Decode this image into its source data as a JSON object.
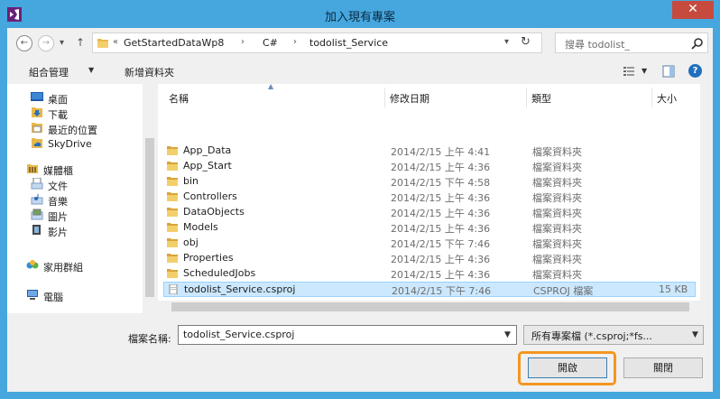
{
  "window": {
    "title": "加入現有專案",
    "close_label": "✕",
    "accent": "#46a7de"
  },
  "address": {
    "crumbs": [
      "«",
      "GetStartedDataWp8",
      "C#",
      "todolist_Service"
    ],
    "search_placeholder": "搜尋 todolist_"
  },
  "toolbar": {
    "organize_label": "組合管理",
    "new_folder_label": "新增資料夾"
  },
  "navigation": {
    "favorites": [
      {
        "label": "桌面",
        "icon": "desktop-icon"
      },
      {
        "label": "下載",
        "icon": "download-folder-icon"
      },
      {
        "label": "最近的位置",
        "icon": "recent-places-icon"
      },
      {
        "label": "SkyDrive",
        "icon": "skydrive-icon"
      }
    ],
    "libraries_label": "媒體櫃",
    "libraries": [
      {
        "label": "文件",
        "icon": "documents-icon"
      },
      {
        "label": "音樂",
        "icon": "music-icon"
      },
      {
        "label": "圖片",
        "icon": "pictures-icon"
      },
      {
        "label": "影片",
        "icon": "videos-icon"
      }
    ],
    "homegroup_label": "家用群組",
    "computer_label": "電腦"
  },
  "columns": {
    "name": "名稱",
    "modified": "修改日期",
    "type": "類型",
    "size": "大小"
  },
  "files": [
    {
      "name": "App_Data",
      "modified": "2014/2/15 上午 4:41",
      "type": "檔案資料夾",
      "size": "",
      "kind": "folder"
    },
    {
      "name": "App_Start",
      "modified": "2014/2/15 上午 4:36",
      "type": "檔案資料夾",
      "size": "",
      "kind": "folder"
    },
    {
      "name": "bin",
      "modified": "2014/2/15 下午 4:58",
      "type": "檔案資料夾",
      "size": "",
      "kind": "folder"
    },
    {
      "name": "Controllers",
      "modified": "2014/2/15 上午 4:36",
      "type": "檔案資料夾",
      "size": "",
      "kind": "folder"
    },
    {
      "name": "DataObjects",
      "modified": "2014/2/15 上午 4:36",
      "type": "檔案資料夾",
      "size": "",
      "kind": "folder"
    },
    {
      "name": "Models",
      "modified": "2014/2/15 上午 4:36",
      "type": "檔案資料夾",
      "size": "",
      "kind": "folder"
    },
    {
      "name": "obj",
      "modified": "2014/2/15 下午 7:46",
      "type": "檔案資料夾",
      "size": "",
      "kind": "folder"
    },
    {
      "name": "Properties",
      "modified": "2014/2/15 上午 4:36",
      "type": "檔案資料夾",
      "size": "",
      "kind": "folder"
    },
    {
      "name": "ScheduledJobs",
      "modified": "2014/2/15 上午 4:36",
      "type": "檔案資料夾",
      "size": "",
      "kind": "folder"
    },
    {
      "name": "todolist_Service.csproj",
      "modified": "2014/2/15 下午 7:46",
      "type": "CSPROJ 檔案",
      "size": "15 KB",
      "kind": "file"
    }
  ],
  "footer": {
    "filename_label": "檔案名稱:",
    "filename_value": "todolist_Service.csproj",
    "filetype_value": "所有專案檔 (*.csproj;*fs...",
    "open_label": "開啟",
    "close_label": "關閉",
    "highlight_color": "#f5961e"
  }
}
